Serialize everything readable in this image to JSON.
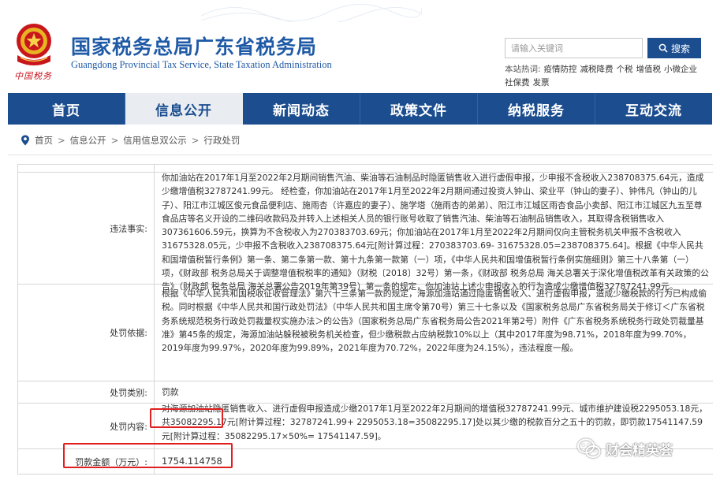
{
  "header": {
    "title": "国家税务总局广东省税务局",
    "subtitle": "Guangdong Provincial Tax Service, State Taxation Administration",
    "logo_caption": "中国税务"
  },
  "search": {
    "placeholder": "请输入关键词",
    "button_label": "搜索",
    "hot_label": "本站热词:",
    "hot_words": [
      "疫情防控",
      "减税降费",
      "个税",
      "增值税",
      "小微企业",
      "社保费",
      "发票"
    ]
  },
  "nav": {
    "items": [
      "首页",
      "信息公开",
      "新闻动态",
      "政策文件",
      "纳税服务",
      "互动交流"
    ],
    "active_index": 1
  },
  "breadcrumb": [
    "首页",
    "信息公开",
    "信用信息双公示",
    "行政处罚"
  ],
  "record": {
    "rows": [
      {
        "label": "违法事实:",
        "value": "你加油站在2017年1月至2022年2月期间销售汽油、柴油等石油制品时隐匿销售收入进行虚假申报，少申报不含税收入238708375.64元，造成少缴增值税32787241.99元。 经检查，你加油站在2017年1月至2022年2月期间通过投资人钟山、梁业平（钟山的妻子）、钟伟凡（钟山的儿子）、阳江市江城区俊元食品便利店、施雨杏（许嘉应的妻子）、施学塔（施雨杏的弟弟）、阳江市江城区雨杏食品小卖部、阳江市江城区九五至尊食品店等名义开设的二维码收款码及并转入上述相关人员的银行账号收取了销售汽油、柴油等石油制品销售收入，其取得含税销售收入307361606.59元，换算为不含税收入为270383703.69元；你加油站在2017年1月至2022年2月期间仅向主管税务机关申报不含税收入31675328.05元，少申报不含税收入238708375.64元[附计算过程：270383703.69- 31675328.05=238708375.64]。根据《中华人民共和国增值税暂行条例》第一条、第二条第一款、第十九条第一款第（一）项，《中华人民共和国增值税暂行条例实施细则》第三十八条第（一）项，《财政部 税务总局关于调整增值税税率的通知》（财税〔2018〕32号）第一条，《财政部 税务总局 海关总署关于深化增值税改革有关政策的公告》（财政部 税务总局 海关总署公告2019年第39号）第一条的规定，你加油站上述少申报收入的行为造成少缴增值税32787241.99元。"
      },
      {
        "label": "处罚依据:",
        "value": "根据《中华人民共和国税收征收管理法》第六十三条第一款的规定，海源加油站通过隐匿销售收入、进行虚假申报，造成少缴税款的行为已构成偷税。同时根据《中华人民共和国行政处罚法》（中华人民共和国主席令第70号）第三十七条以及《国家税务总局广东省税务局关于修订＜广东省税务系统规范税务行政处罚裁量权实施办法＞的公告》（国家税务总局广东省税务局公告2021年第2号）附件《广东省税务系统税务行政处罚裁量基准》第45条的规定，海源加油站躲税被税务机关检查，但少缴税款占应纳税款10%以上（其中2017年度为98.71%，2018年度为99.70%，2019年度为99.97%，2020年度为99.89%，2021年度为70.72%，2022年度为24.15%），违法程度一般。"
      },
      {
        "label": "处罚类别:",
        "value": "罚款"
      },
      {
        "label": "处罚内容:",
        "value": "对海源加油站隐匿销售收入、进行虚假申报造成少缴2017年1月至2022年2月期间的增值税32787241.99元、城市维护建设税2295053.18元，共35082295.17元[附计算过程：32787241.99+ 2295053.18=35082295.17]处以其少缴的税款百分之五十的罚款，即罚款17541147.59元[附计算过程：35082295.17×50%= 17541147.59]。"
      },
      {
        "label": "罚款金额（万元）:",
        "value": "1754.114758"
      }
    ]
  },
  "watermark": {
    "text": "财会精英荟"
  },
  "colors": {
    "brand_blue": "#1b4d8f",
    "title_blue": "#1f5aa6",
    "highlight_red": "#e02020",
    "emblem_red": "#c8161d"
  }
}
